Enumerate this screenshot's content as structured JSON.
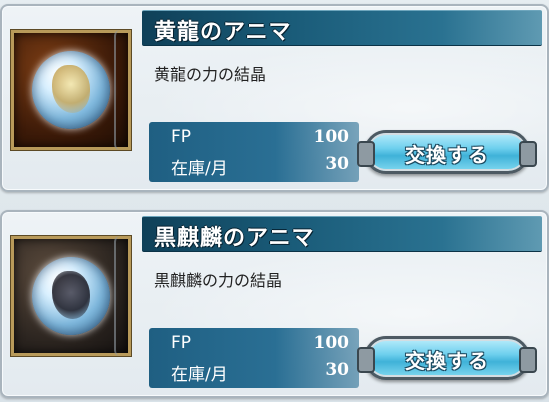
{
  "items": [
    {
      "title": "黄龍のアニマ",
      "description": "黄龍の力の結晶",
      "stats": {
        "fp_label": "FP",
        "fp_value": "100",
        "stock_label": "在庫/月",
        "stock_value": "30"
      },
      "button_label": "交換する",
      "icon": "yellow-dragon-anima-orb-icon"
    },
    {
      "title": "黒麒麟のアニマ",
      "description": "黒麒麟の力の結晶",
      "stats": {
        "fp_label": "FP",
        "fp_value": "100",
        "stock_label": "在庫/月",
        "stock_value": "30"
      },
      "button_label": "交換する",
      "icon": "black-kirin-anima-orb-icon"
    }
  ],
  "colors": {
    "title_bar": "#195a77",
    "stats_panel": "#2a6f94",
    "button": "#6fd0ee",
    "frame_gold": "#b89a5a"
  }
}
